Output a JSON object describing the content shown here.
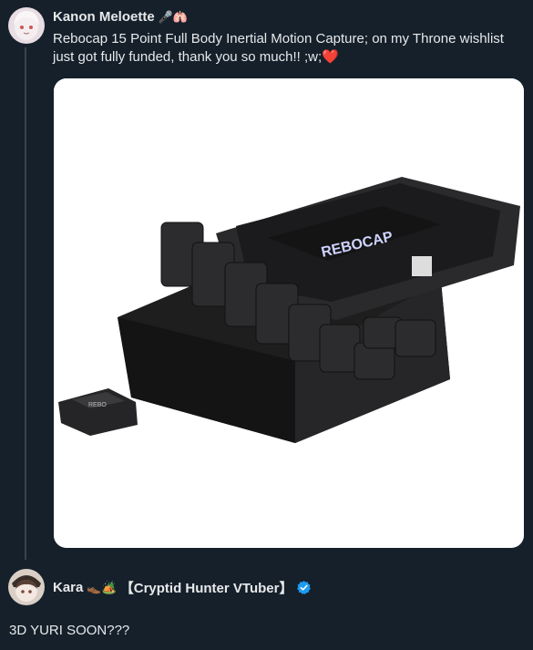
{
  "tweet1": {
    "author_name": "Kanon Meloette",
    "name_emojis": "🎤🫁",
    "text": "Rebocap 15 Point Full Body Inertial Motion Capture; on my Throne wishlist just got fully funded, thank you so much!! ;w;❤️",
    "media": {
      "brand_label": "REBOCAP",
      "sensor_label": "REBO"
    }
  },
  "tweet2": {
    "author_name": "Kara",
    "name_emojis": "👞🏕️",
    "name_suffix": "【Cryptid Hunter VTuber】",
    "verified_icon": "verified-badge-icon",
    "text": "3D YURI SOON???"
  },
  "colors": {
    "background": "#15202b",
    "text": "#e7e9ea",
    "verified": "#1d9bf0",
    "thread_line": "#38444d"
  }
}
